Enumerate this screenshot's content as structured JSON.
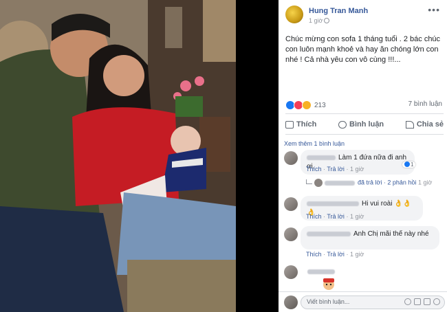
{
  "post": {
    "author": "Hung Tran Manh",
    "time": "1 giờ",
    "text": "Chúc mừng con sofa 1 tháng tuổi . 2 bác chúc con luôn mạnh khoẻ và hay ăn chóng lớn con nhé ! Cả nhà yêu con vô cùng !!!...",
    "reaction_count": "213",
    "shares": "7 bình luận",
    "actions": {
      "like": "Thích",
      "comment": "Bình luận",
      "share": "Chia sẻ"
    }
  },
  "comments": {
    "more_link": "Xem thêm 1 bình luận",
    "items": [
      {
        "text": "Làm 1 đứa nữa đi anh ơi.",
        "like_label": "Thích",
        "reply_label": "Trả lời",
        "time": "1 giờ",
        "reactions": "1"
      },
      {
        "text": "Hi vui roài 👌👌👌",
        "like_label": "Thích",
        "reply_label": "Trả lời",
        "time": "1 giờ"
      },
      {
        "text": "Anh Chị mãi thế này nhé",
        "like_label": "Thích",
        "reply_label": "Trả lời",
        "time": "1 giờ"
      }
    ],
    "reply_summary": {
      "text": "đã trả lời · 2 phản hồi",
      "time": "1 giờ"
    }
  },
  "composer": {
    "placeholder": "Viết bình luận..."
  },
  "colors": {
    "link": "#365899",
    "bubble": "#f2f3f5",
    "like": "#1877f2"
  }
}
